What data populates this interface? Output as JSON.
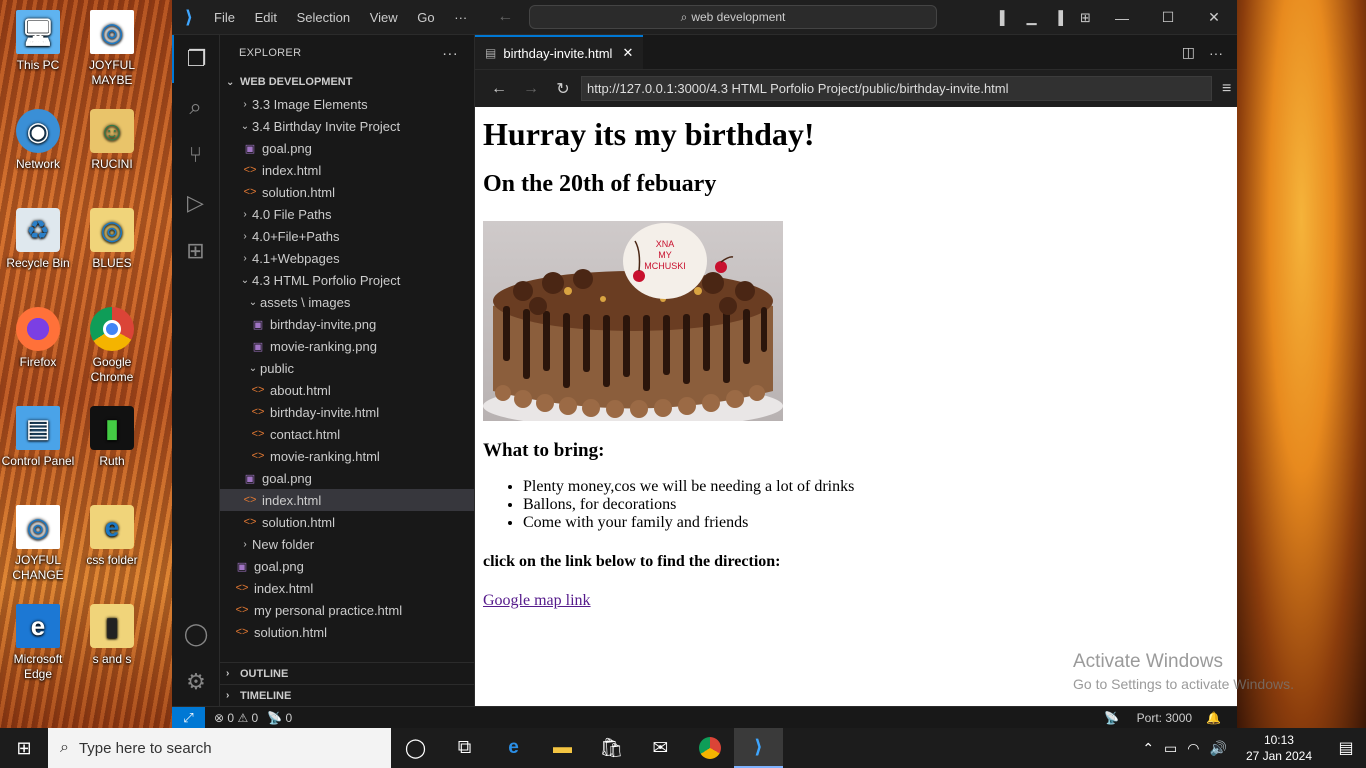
{
  "desktop": {
    "icons": [
      {
        "label": "This PC"
      },
      {
        "label": "JOYFUL MAYBE"
      },
      {
        "label": "Network"
      },
      {
        "label": "RUCINI"
      },
      {
        "label": "Recycle Bin"
      },
      {
        "label": "BLUES"
      },
      {
        "label": "Firefox"
      },
      {
        "label": "Google Chrome"
      },
      {
        "label": "Control Panel"
      },
      {
        "label": "Ruth"
      },
      {
        "label": "JOYFUL CHANGE"
      },
      {
        "label": "css folder"
      },
      {
        "label": "Microsoft Edge"
      },
      {
        "label": "s and s"
      }
    ]
  },
  "titlebar": {
    "menus": [
      "File",
      "Edit",
      "Selection",
      "View",
      "Go"
    ],
    "more": "···",
    "search": "web development"
  },
  "explorer": {
    "header": "EXPLORER",
    "more": "···",
    "root": "WEB DEVELOPMENT",
    "items": [
      {
        "label": "3.3 Image Elements"
      },
      {
        "label": "3.4 Birthday Invite Project"
      },
      {
        "label": "goal.png"
      },
      {
        "label": "index.html"
      },
      {
        "label": "solution.html"
      },
      {
        "label": "4.0 File Paths"
      },
      {
        "label": "4.0+File+Paths"
      },
      {
        "label": "4.1+Webpages"
      },
      {
        "label": "4.3 HTML Porfolio Project"
      },
      {
        "label": "assets \\ images"
      },
      {
        "label": "birthday-invite.png"
      },
      {
        "label": "movie-ranking.png"
      },
      {
        "label": "public"
      },
      {
        "label": "about.html"
      },
      {
        "label": "birthday-invite.html"
      },
      {
        "label": "contact.html"
      },
      {
        "label": "movie-ranking.html"
      },
      {
        "label": "goal.png"
      },
      {
        "label": "index.html"
      },
      {
        "label": "solution.html"
      },
      {
        "label": "New folder"
      },
      {
        "label": "goal.png"
      },
      {
        "label": "index.html"
      },
      {
        "label": "my personal practice.html"
      },
      {
        "label": "solution.html"
      }
    ],
    "outline": "OUTLINE",
    "timeline": "TIMELINE"
  },
  "editor": {
    "tab_label": "birthday-invite.html",
    "url": "http://127.0.0.1:3000/4.3 HTML Porfolio Project/public/birthday-invite.html"
  },
  "webpage": {
    "h1": "Hurray its my birthday!",
    "h2": "On the 20th of febuary",
    "cake_text": "XNA\nMY\nMCHUSKI",
    "bring_heading": "What to bring:",
    "bring_items": [
      "Plenty money,cos we will be needing a lot of drinks",
      "Ballons, for decorations",
      "Come with your family and friends"
    ],
    "direction_text": "click on the link below to find the direction:",
    "link_text": "Google map link"
  },
  "watermark": {
    "line1": "Activate Windows",
    "line2": "Go to Settings to activate Windows."
  },
  "statusbar": {
    "errors": "0",
    "warnings": "0",
    "ports_count": "0",
    "port": "Port: 3000"
  },
  "taskbar": {
    "search_placeholder": "Type here to search",
    "time": "10:13",
    "date": "27 Jan 2024"
  }
}
